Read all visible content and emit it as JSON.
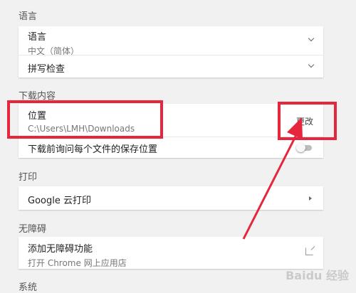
{
  "sections": {
    "language": {
      "title": "语言",
      "language_row": {
        "label": "语言",
        "value": "中文（简体）"
      },
      "spellcheck_row": {
        "label": "拼写检查"
      }
    },
    "downloads": {
      "title": "下载内容",
      "location_row": {
        "label": "位置",
        "path": "C:\\Users\\LMH\\Downloads",
        "change_label": "更改"
      },
      "ask_row": {
        "label": "下载前询问每个文件的保存位置",
        "toggle_on": false
      }
    },
    "printing": {
      "title": "打印",
      "cloud_print_row": {
        "label": "Google 云打印"
      }
    },
    "accessibility": {
      "title": "无障碍",
      "add_features_row": {
        "label": "添加无障碍功能",
        "sublabel": "打开 Chrome 网上应用店"
      }
    },
    "system": {
      "title": "系统"
    }
  },
  "annotation_color": "#e5263d",
  "watermark_text": "Baidu 经验"
}
